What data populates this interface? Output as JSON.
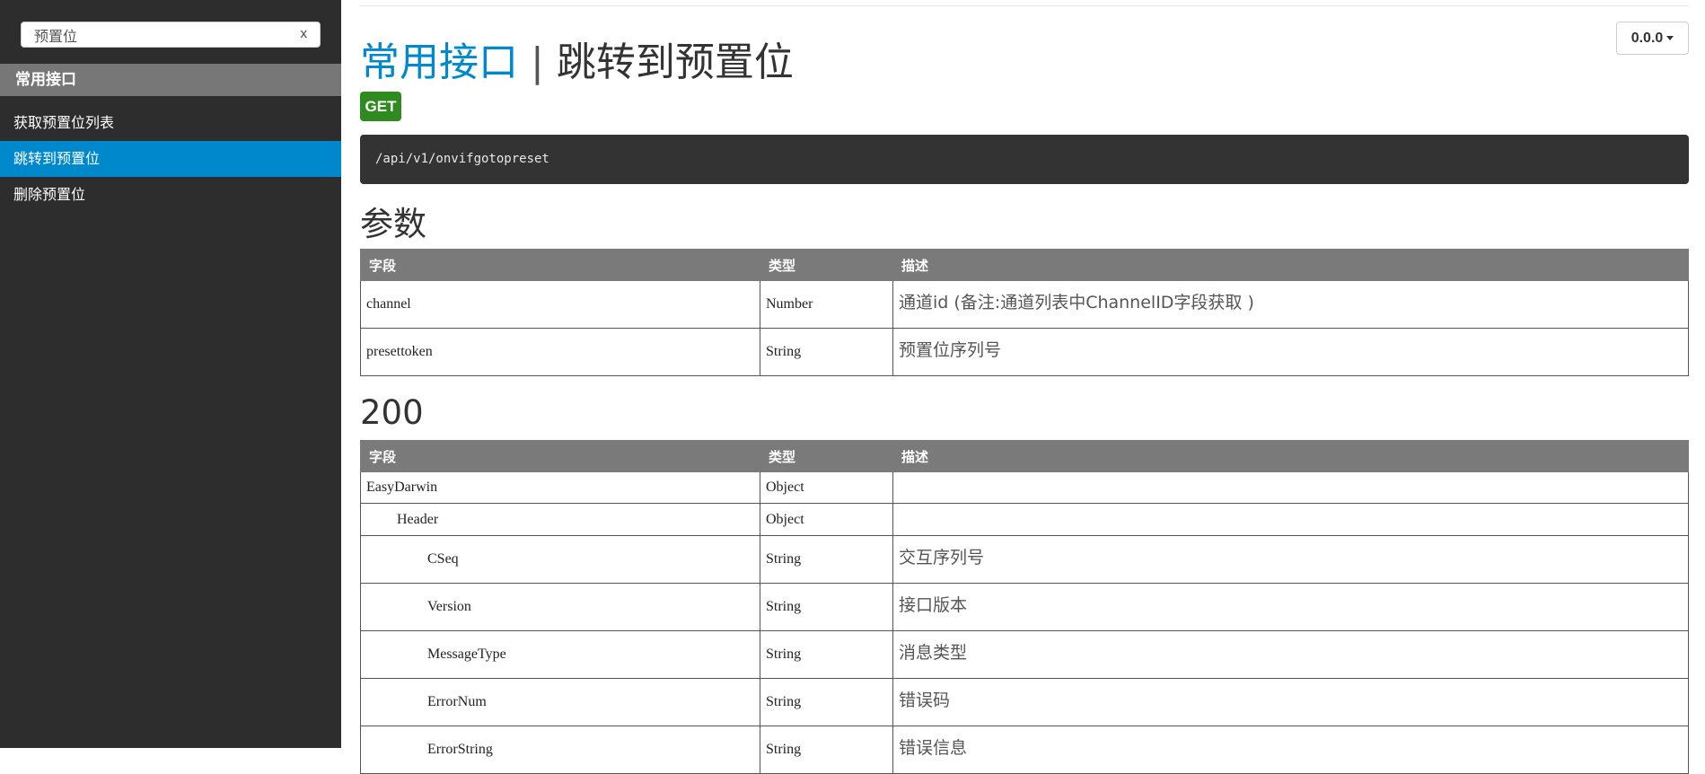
{
  "sidebar": {
    "search": {
      "value": "预置位",
      "clear": "x"
    },
    "group_title": "常用接口",
    "items": [
      {
        "label": "获取预置位列表",
        "active": false
      },
      {
        "label": "跳转到预置位",
        "active": true
      },
      {
        "label": "删除预置位",
        "active": false
      }
    ]
  },
  "header": {
    "version": "0.0.0",
    "title_group": "常用接口",
    "title_sep": "|",
    "title_name": "跳转到预置位",
    "method": "GET",
    "url": "/api/v1/onvifgotopreset"
  },
  "params": {
    "title": "参数",
    "headers": [
      "字段",
      "类型",
      "描述"
    ],
    "rows": [
      {
        "field": "channel",
        "type": "Number",
        "desc": "通道id (备注:通道列表中ChannelID字段获取 )"
      },
      {
        "field": "presettoken",
        "type": "String",
        "desc": "预置位序列号"
      }
    ]
  },
  "response": {
    "title": "200",
    "headers": [
      "字段",
      "类型",
      "描述"
    ],
    "rows": [
      {
        "field": "EasyDarwin",
        "type": "Object",
        "desc": ""
      },
      {
        "field": "Header",
        "type": "Object",
        "desc": ""
      },
      {
        "field": "CSeq",
        "type": "String",
        "desc": "交互序列号"
      },
      {
        "field": "Version",
        "type": "String",
        "desc": "接口版本"
      },
      {
        "field": "MessageType",
        "type": "String",
        "desc": "消息类型"
      },
      {
        "field": "ErrorNum",
        "type": "String",
        "desc": "错误码"
      },
      {
        "field": "ErrorString",
        "type": "String",
        "desc": "错误信息"
      }
    ]
  },
  "colors": {
    "sidebar_bg": "#2d2d2d",
    "accent": "#0088cc",
    "get_badge": "#2f8a1f",
    "table_header": "#7a7a7a",
    "url_box": "#333333"
  }
}
